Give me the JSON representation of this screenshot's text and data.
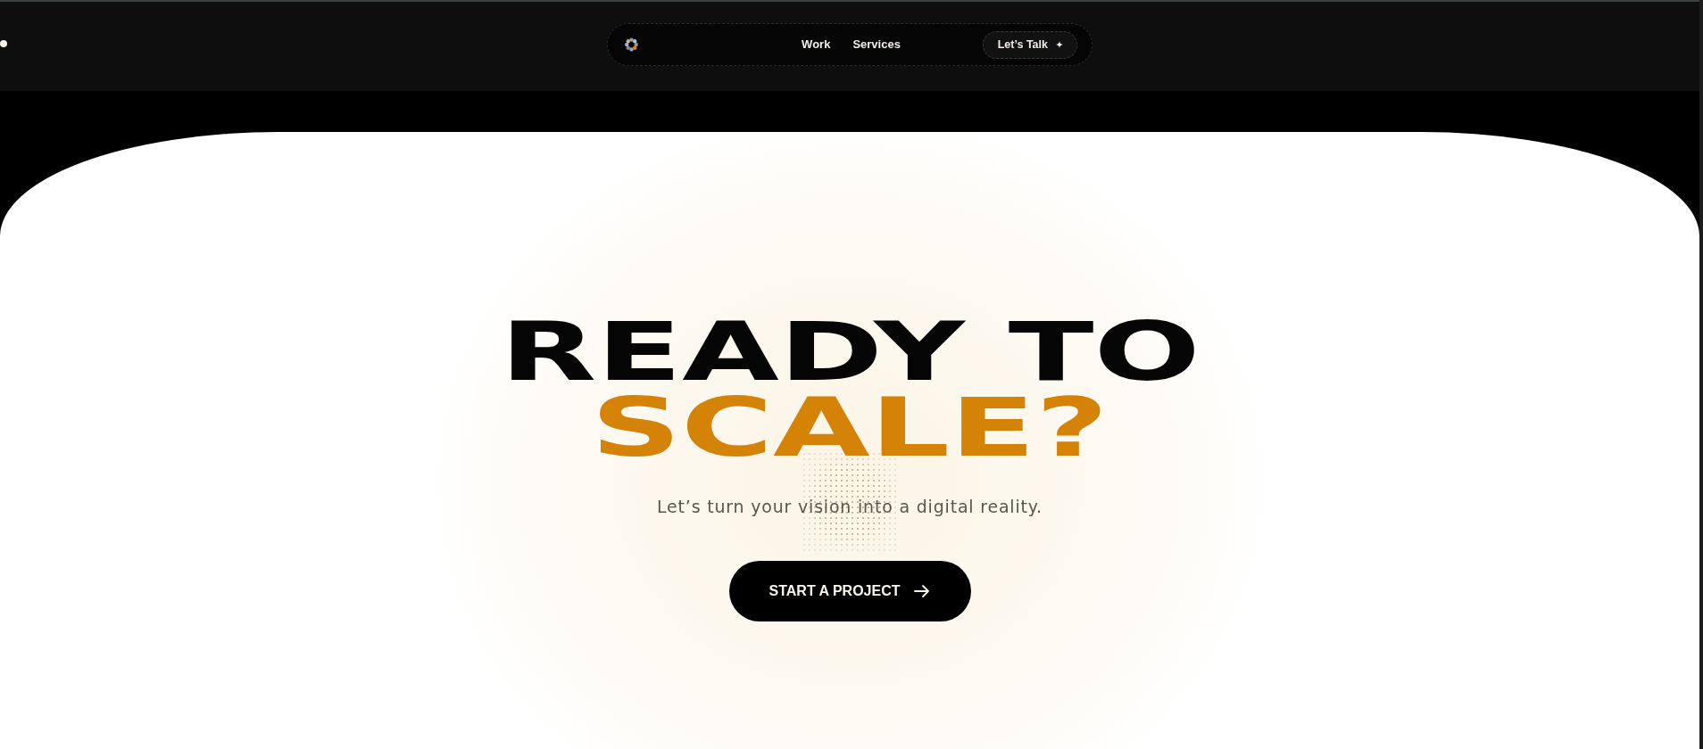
{
  "header": {
    "nav": {
      "links": [
        {
          "label": "Work"
        },
        {
          "label": "Services"
        }
      ],
      "cta": {
        "label": "Let’s Talk"
      }
    }
  },
  "hero": {
    "title_lines": [
      {
        "text": "READY TO",
        "kind": "plain"
      },
      {
        "text": "SCALE?",
        "kind": "accent"
      }
    ],
    "subtitle": "Let’s turn your vision into a digital reality.",
    "button": {
      "label": "START A PROJECT"
    }
  }
}
